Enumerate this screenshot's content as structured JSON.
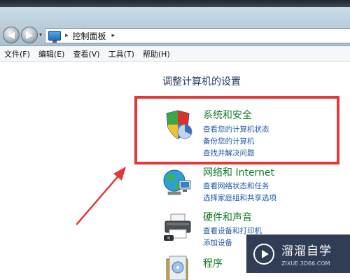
{
  "address_bar": {
    "breadcrumb": "控制面板",
    "separator": "▸"
  },
  "menu": {
    "items": [
      "文件(F)",
      "编辑(E)",
      "查看(V)",
      "工具(T)",
      "帮助(H)"
    ]
  },
  "page": {
    "title": "调整计算机的设置"
  },
  "categories": [
    {
      "heading": "系统和安全",
      "icon": "shield-system-icon",
      "links": [
        "查看您的计算机状态",
        "备份您的计算机",
        "查找并解决问题"
      ]
    },
    {
      "heading": "网络和 Internet",
      "icon": "network-globe-icon",
      "links": [
        "查看网络状态和任务",
        "选择家庭组和共享选项"
      ]
    },
    {
      "heading": "硬件和声音",
      "icon": "printer-hardware-icon",
      "links": [
        "查看设备和打印机",
        "添加设备"
      ]
    },
    {
      "heading": "程序",
      "icon": "programs-icon",
      "links": []
    }
  ],
  "annotation": {
    "highlight_color": "#e23a3a"
  },
  "watermark": {
    "title": "溜溜自学",
    "url": "ZIXUE.3D66.COM"
  }
}
